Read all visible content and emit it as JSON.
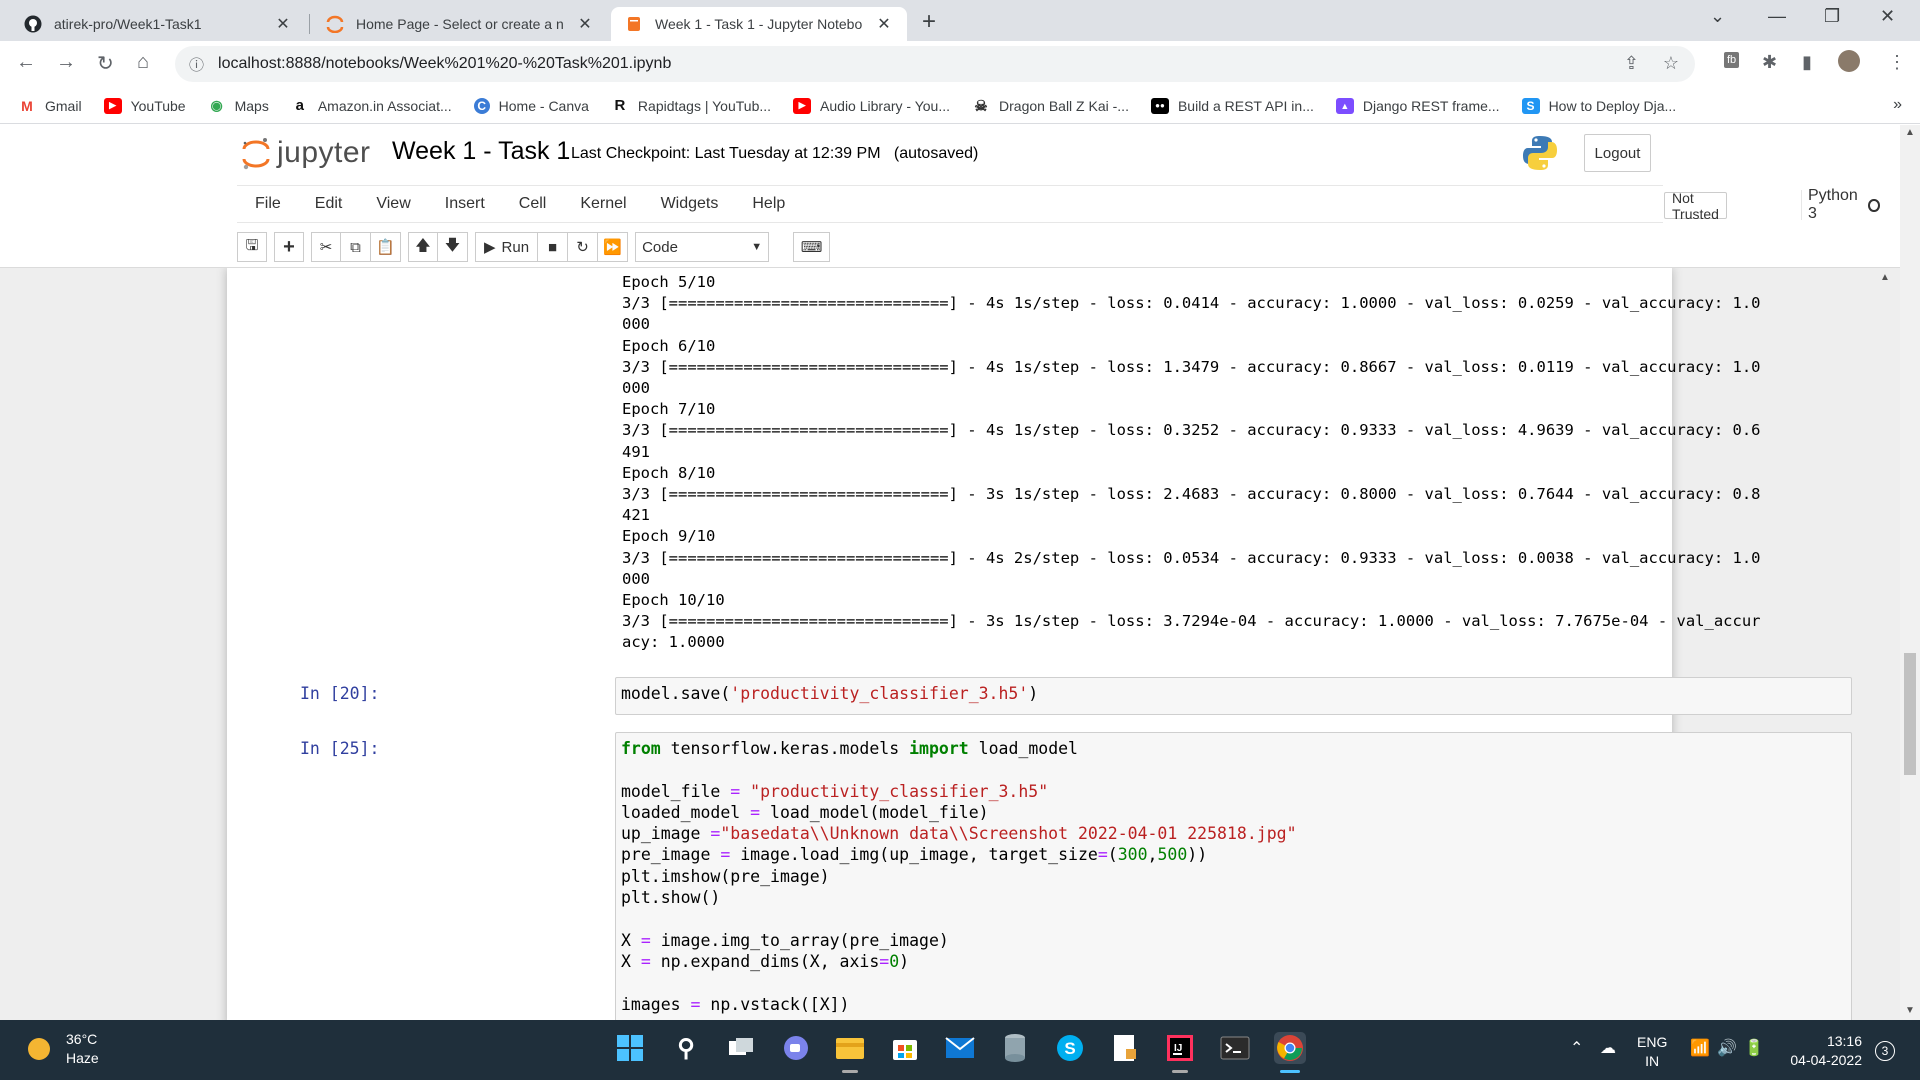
{
  "browser": {
    "tabs": [
      {
        "title": "atirek-pro/Week1-Task1",
        "close": "✕"
      },
      {
        "title": "Home Page - Select or create a n",
        "close": "✕"
      },
      {
        "title": "Week 1 - Task 1 - Jupyter Notebo",
        "close": "✕"
      }
    ],
    "new_tab": "+",
    "url": "localhost:8888/notebooks/Week%201%20-%20Task%201.ipynb",
    "bookmarks": [
      {
        "label": "Gmail",
        "icon": "gmail-icon",
        "glyph": "M",
        "color": "#ea4335"
      },
      {
        "label": "YouTube",
        "icon": "youtube-icon",
        "glyph": "▶",
        "color": "#ff0000"
      },
      {
        "label": "Maps",
        "icon": "maps-icon",
        "glyph": "◉",
        "color": "#34a853"
      },
      {
        "label": "Amazon.in Associat...",
        "icon": "amazon-icon",
        "glyph": "a",
        "color": "#111111"
      },
      {
        "label": "Home - Canva",
        "icon": "canva-icon",
        "glyph": "C",
        "color": "#3b7cd6"
      },
      {
        "label": "Rapidtags | YouTub...",
        "icon": "rapidtags-icon",
        "glyph": "R",
        "color": "#111111"
      },
      {
        "label": "Audio Library - You...",
        "icon": "youtube-icon",
        "glyph": "▶",
        "color": "#ff0000"
      },
      {
        "label": "Dragon Ball Z Kai -...",
        "icon": "onepiece-icon",
        "glyph": "☠",
        "color": "#333333"
      },
      {
        "label": "Build a REST API in...",
        "icon": "medium-icon",
        "glyph": "●●",
        "color": "#000000"
      },
      {
        "label": "Django REST frame...",
        "icon": "django-icon",
        "glyph": "▲",
        "color": "#7c4dff"
      },
      {
        "label": "How to Deploy Dja...",
        "icon": "stackedit-icon",
        "glyph": "S",
        "color": "#2196f3"
      }
    ],
    "bookmarks_more": "»"
  },
  "jupyter": {
    "logo_text": "jupyter",
    "notebook_title": "Week 1 - Task 1",
    "checkpoint": "Last Checkpoint: Last Tuesday at 12:39 PM",
    "autosaved": "(autosaved)",
    "logout": "Logout",
    "menu": [
      "File",
      "Edit",
      "View",
      "Insert",
      "Cell",
      "Kernel",
      "Widgets",
      "Help"
    ],
    "not_trusted": "Not Trusted",
    "kernel": "Python 3",
    "run_label": "Run",
    "cell_type": "Code"
  },
  "cells": {
    "output_lines": [
      "Epoch 5/10",
      "3/3 [==============================] - 4s 1s/step - loss: 0.0414 - accuracy: 1.0000 - val_loss: 0.0259 - val_accuracy: 1.0",
      "000",
      "Epoch 6/10",
      "3/3 [==============================] - 4s 1s/step - loss: 1.3479 - accuracy: 0.8667 - val_loss: 0.0119 - val_accuracy: 1.0",
      "000",
      "Epoch 7/10",
      "3/3 [==============================] - 4s 1s/step - loss: 0.3252 - accuracy: 0.9333 - val_loss: 4.9639 - val_accuracy: 0.6",
      "491",
      "Epoch 8/10",
      "3/3 [==============================] - 3s 1s/step - loss: 2.4683 - accuracy: 0.8000 - val_loss: 0.7644 - val_accuracy: 0.8",
      "421",
      "Epoch 9/10",
      "3/3 [==============================] - 4s 2s/step - loss: 0.0534 - accuracy: 0.9333 - val_loss: 0.0038 - val_accuracy: 1.0",
      "000",
      "Epoch 10/10",
      "3/3 [==============================] - 3s 1s/step - loss: 3.7294e-04 - accuracy: 1.0000 - val_loss: 7.7675e-04 - val_accur",
      "acy: 1.0000"
    ],
    "cell20_prompt": "In [20]:",
    "cell20_code_a": "model.save(",
    "cell20_code_str": "'productivity_classifier_3.h5'",
    "cell20_code_b": ")",
    "cell25_prompt": "In [25]:",
    "cell25": {
      "l1_kw1": "from",
      "l1_mid": " tensorflow.keras.models ",
      "l1_kw2": "import",
      "l1_end": " load_model",
      "l3_a": "model_file ",
      "l3_op": "=",
      "l3_str": " \"productivity_classifier_3.h5\"",
      "l4_a": "loaded_model ",
      "l4_op": "=",
      "l4_b": " load_model(model_file)",
      "l5_a": "up_image ",
      "l5_op": "=",
      "l5_str": "\"basedata\\\\Unknown data\\\\Screenshot 2022-04-01 225818.jpg\"",
      "l6_a": "pre_image ",
      "l6_op": "=",
      "l6_b": " image.load_img(up_image, target_size",
      "l6_op2": "=",
      "l6_c": "(",
      "l6_n1": "300",
      "l6_d": ",",
      "l6_n2": "500",
      "l6_e": "))",
      "l7": "plt.imshow(pre_image)",
      "l8": "plt.show()",
      "l10_a": "X ",
      "l10_op": "=",
      "l10_b": " image.img_to_array(pre_image)",
      "l11_a": "X ",
      "l11_op": "=",
      "l11_b": " np.expand_dims(X, axis",
      "l11_op2": "=",
      "l11_n": "0",
      "l11_c": ")",
      "l13_a": "images ",
      "l13_op": "=",
      "l13_b": " np.vstack([X])"
    }
  },
  "taskbar": {
    "temp": "36°C",
    "condition": "Haze",
    "lang1": "ENG",
    "lang2": "IN",
    "time": "13:16",
    "date": "04-04-2022",
    "notifications": "3"
  },
  "colors": {
    "prompt": "#303f9f",
    "keyword": "#008000",
    "string": "#ba2121",
    "operator": "#aa22ff",
    "taskbar": "#1f2f3b"
  }
}
